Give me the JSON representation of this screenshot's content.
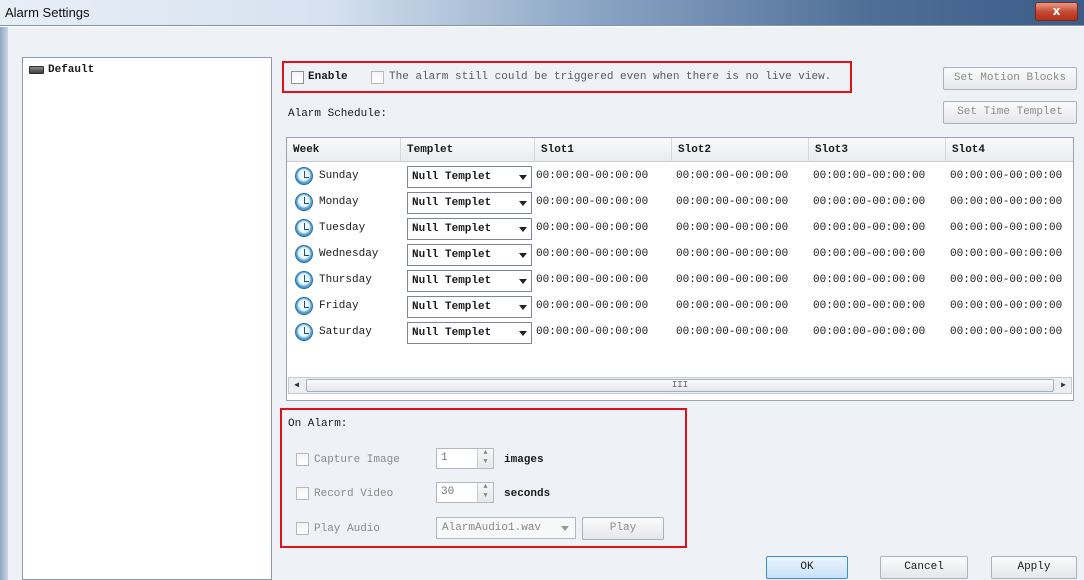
{
  "window": {
    "title": "Alarm Settings",
    "close_label": "x"
  },
  "tree": {
    "items": [
      {
        "label": "Default"
      }
    ]
  },
  "enable": {
    "label": "Enable",
    "checked": false,
    "no_live_view_label": "The alarm still could be triggered even when there is no live view.",
    "no_live_view_checked": false
  },
  "buttons": {
    "set_motion_blocks": "Set Motion Blocks",
    "set_time_templet": "Set Time Templet",
    "ok": "OK",
    "cancel": "Cancel",
    "apply": "Apply"
  },
  "schedule": {
    "label": "Alarm Schedule:",
    "columns": [
      "Week",
      "Templet",
      "Slot1",
      "Slot2",
      "Slot3",
      "Slot4"
    ],
    "rows": [
      {
        "day": "Sunday",
        "templet": "Null Templet",
        "slot1": "00:00:00-00:00:00",
        "slot2": "00:00:00-00:00:00",
        "slot3": "00:00:00-00:00:00",
        "slot4": "00:00:00-00:00:00"
      },
      {
        "day": "Monday",
        "templet": "Null Templet",
        "slot1": "00:00:00-00:00:00",
        "slot2": "00:00:00-00:00:00",
        "slot3": "00:00:00-00:00:00",
        "slot4": "00:00:00-00:00:00"
      },
      {
        "day": "Tuesday",
        "templet": "Null Templet",
        "slot1": "00:00:00-00:00:00",
        "slot2": "00:00:00-00:00:00",
        "slot3": "00:00:00-00:00:00",
        "slot4": "00:00:00-00:00:00"
      },
      {
        "day": "Wednesday",
        "templet": "Null Templet",
        "slot1": "00:00:00-00:00:00",
        "slot2": "00:00:00-00:00:00",
        "slot3": "00:00:00-00:00:00",
        "slot4": "00:00:00-00:00:00"
      },
      {
        "day": "Thursday",
        "templet": "Null Templet",
        "slot1": "00:00:00-00:00:00",
        "slot2": "00:00:00-00:00:00",
        "slot3": "00:00:00-00:00:00",
        "slot4": "00:00:00-00:00:00"
      },
      {
        "day": "Friday",
        "templet": "Null Templet",
        "slot1": "00:00:00-00:00:00",
        "slot2": "00:00:00-00:00:00",
        "slot3": "00:00:00-00:00:00",
        "slot4": "00:00:00-00:00:00"
      },
      {
        "day": "Saturday",
        "templet": "Null Templet",
        "slot1": "00:00:00-00:00:00",
        "slot2": "00:00:00-00:00:00",
        "slot3": "00:00:00-00:00:00",
        "slot4": "00:00:00-00:00:00"
      }
    ],
    "scroll_grip": "III"
  },
  "on_alarm": {
    "label": "On Alarm:",
    "capture_image": {
      "label": "Capture Image",
      "value": "1",
      "unit": "images",
      "checked": false
    },
    "record_video": {
      "label": "Record Video",
      "value": "30",
      "unit": "seconds",
      "checked": false
    },
    "play_audio": {
      "label": "Play Audio",
      "file": "AlarmAudio1.wav",
      "play_label": "Play",
      "checked": false
    }
  },
  "icons": {
    "close": "close-icon",
    "device": "dvr-device-icon",
    "schedule": "clock-icon",
    "dropdown": "chevron-down-icon"
  },
  "colors": {
    "highlight": "#e0101d",
    "close_button": "#c4472f",
    "clock": "#2f7db8"
  }
}
